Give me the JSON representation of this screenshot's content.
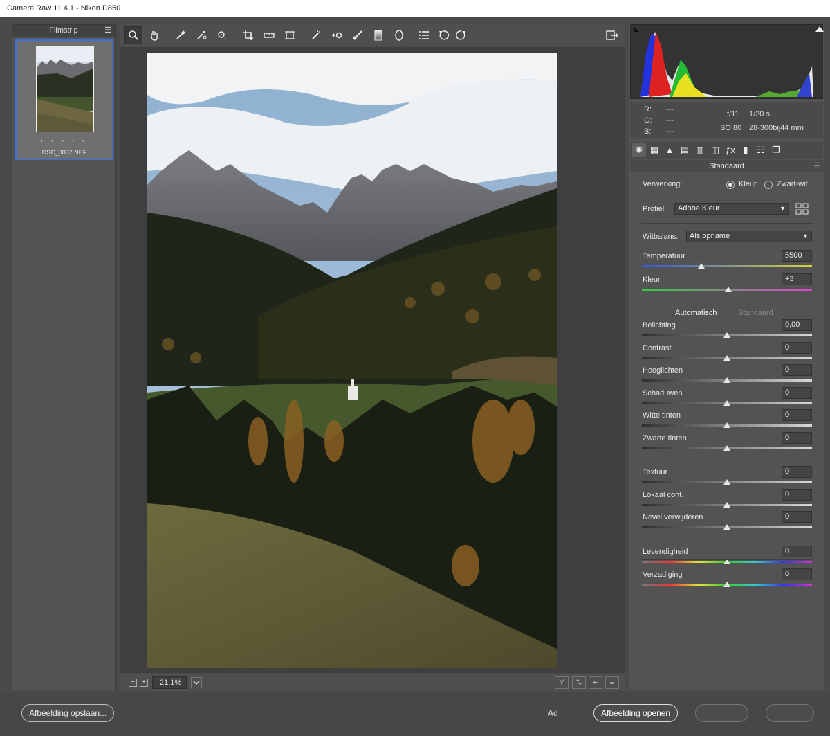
{
  "window": {
    "title": "Camera Raw 11.4.1  -  Nikon D850"
  },
  "filmstrip": {
    "title": "Filmstrip",
    "file_name": "DSC_0037.NEF",
    "rating": "• • • • •"
  },
  "toolbar": {
    "tools": [
      "zoom-icon",
      "hand-icon",
      "white-balance-icon",
      "color-sampler-icon",
      "target-adjust-icon",
      "crop-icon",
      "straighten-icon",
      "transform-icon",
      "spot-removal-icon",
      "red-eye-icon",
      "adjustment-brush-icon",
      "graduated-filter-icon",
      "radial-filter-icon",
      "preferences-icon",
      "rotate-left-icon",
      "rotate-right-icon"
    ]
  },
  "zoom": {
    "value": "21,1%"
  },
  "info": {
    "r_label": "R:",
    "g_label": "G:",
    "b_label": "B:",
    "r_val": "---",
    "g_val": "---",
    "b_val": "---",
    "aperture": "f/11",
    "shutter": "1/20 s",
    "iso": "ISO 80",
    "lens": "28-300bij44 mm"
  },
  "panel": {
    "section_title": "Standaard",
    "processing_label": "Verwerking:",
    "color_option": "Kleur",
    "bw_option": "Zwart-wit",
    "profile_label": "Profiel:",
    "profile_value": "Adobe Kleur",
    "wb_label": "Witbalans:",
    "wb_value": "Als opname",
    "auto_label": "Automatisch",
    "default_label": "Standaard",
    "sliders": [
      {
        "label": "Temperatuur",
        "value": "5500",
        "pos": 0.35
      },
      {
        "label": "Kleur",
        "value": "+3",
        "pos": 0.51
      },
      {
        "label": "Belichting",
        "value": "0,00",
        "pos": 0.5
      },
      {
        "label": "Contrast",
        "value": "0",
        "pos": 0.5
      },
      {
        "label": "Hooglichten",
        "value": "0",
        "pos": 0.5
      },
      {
        "label": "Schaduwen",
        "value": "0",
        "pos": 0.5
      },
      {
        "label": "Witte tinten",
        "value": "0",
        "pos": 0.5
      },
      {
        "label": "Zwarte tinten",
        "value": "0",
        "pos": 0.5
      },
      {
        "label": "Textuur",
        "value": "0",
        "pos": 0.5
      },
      {
        "label": "Lokaal cont.",
        "value": "0",
        "pos": 0.5
      },
      {
        "label": "Nevel verwijderen",
        "value": "0",
        "pos": 0.5
      },
      {
        "label": "Levendigheid",
        "value": "0",
        "pos": 0.5
      },
      {
        "label": "Verzadiging",
        "value": "0",
        "pos": 0.5
      }
    ]
  },
  "bottom": {
    "save_label": "Afbeelding opslaan...",
    "ad_label": "Ad",
    "open_label": "Afbeelding openen"
  },
  "colors": {
    "accent": "#3d6fd6"
  }
}
